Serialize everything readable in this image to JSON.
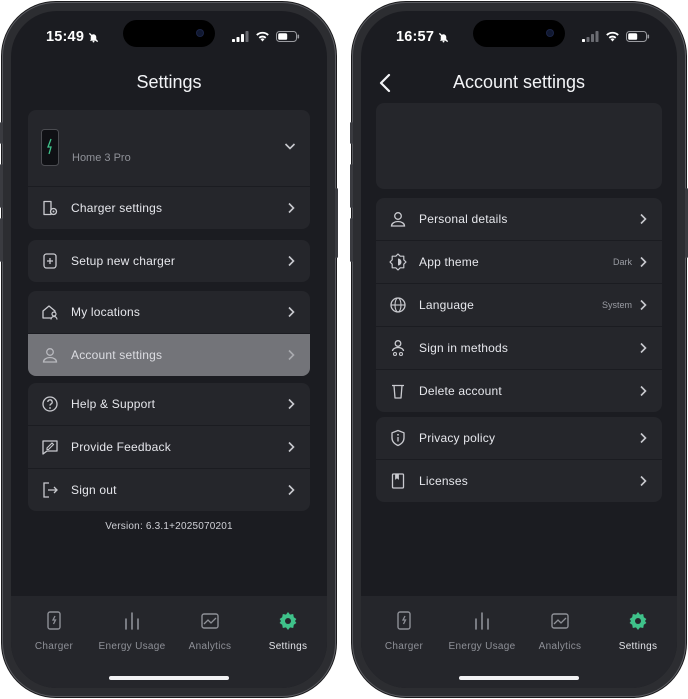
{
  "left": {
    "status": {
      "time": "15:49"
    },
    "title": "Settings",
    "charger": {
      "name": "Home 3 Pro"
    },
    "group1": [
      {
        "label": "Charger settings",
        "icon": "charger-gear-icon"
      }
    ],
    "group2": [
      {
        "label": "Setup new charger",
        "icon": "plus-square-icon"
      }
    ],
    "group3": [
      {
        "label": "My locations",
        "icon": "home-person-icon"
      },
      {
        "label": "Account settings",
        "icon": "person-icon",
        "active": true
      }
    ],
    "group4": [
      {
        "label": "Help & Support",
        "icon": "question-circle-icon"
      },
      {
        "label": "Provide Feedback",
        "icon": "feedback-icon"
      },
      {
        "label": "Sign out",
        "icon": "sign-out-icon"
      }
    ],
    "version": "Version: 6.3.1+2025070201"
  },
  "right": {
    "status": {
      "time": "16:57"
    },
    "title": "Account settings",
    "group1": [
      {
        "label": "Personal details",
        "value": "",
        "icon": "person-icon"
      },
      {
        "label": "App theme",
        "value": "Dark",
        "icon": "theme-icon"
      },
      {
        "label": "Language",
        "value": "System",
        "icon": "globe-icon"
      },
      {
        "label": "Sign in methods",
        "value": "",
        "icon": "person-key-icon"
      },
      {
        "label": "Delete account",
        "value": "",
        "icon": "trash-icon"
      }
    ],
    "group2": [
      {
        "label": "Privacy policy",
        "icon": "shield-info-icon"
      },
      {
        "label": "Licenses",
        "icon": "bookmark-icon"
      }
    ]
  },
  "tabs": [
    {
      "label": "Charger",
      "icon": "charger-icon"
    },
    {
      "label": "Energy Usage",
      "icon": "bars-icon"
    },
    {
      "label": "Analytics",
      "icon": "analytics-icon"
    },
    {
      "label": "Settings",
      "icon": "gear-icon",
      "active": true
    }
  ],
  "colors": {
    "accent": "#3fc28a",
    "background": "#1b1c21",
    "card": "#25262b",
    "active_row": "#737479"
  }
}
